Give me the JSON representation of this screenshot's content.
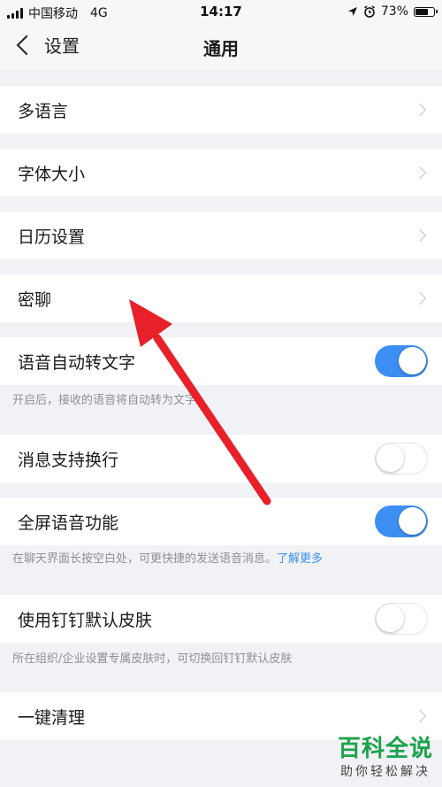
{
  "status_bar": {
    "carrier": "中国移动",
    "network": "4G",
    "time": "14:17",
    "battery_percent": "73%",
    "battery_level": 0.73
  },
  "nav": {
    "back_label": "设置",
    "title": "通用"
  },
  "rows": {
    "language": "多语言",
    "font_size": "字体大小",
    "calendar": "日历设置",
    "secret_chat": "密聊",
    "voice_to_text": "语音自动转文字",
    "line_break": "消息支持换行",
    "fullscreen_voice": "全屏语音功能",
    "default_skin": "使用钉钉默认皮肤",
    "cleanup": "一键清理"
  },
  "toggles": {
    "voice_to_text": true,
    "line_break": false,
    "fullscreen_voice": true,
    "default_skin": false
  },
  "hints": {
    "voice_to_text": "开启后，接收的语音将自动转为文字。",
    "fullscreen_voice": "在聊天界面长按空白处，可更快捷的发送语音消息。",
    "fullscreen_voice_link": "了解更多",
    "default_skin": "所在组织/企业设置专属皮肤时，可切换回钉钉默认皮肤"
  },
  "watermark": {
    "brand": "百科全说",
    "tagline": "助你轻松解决"
  },
  "colors": {
    "accent": "#3d8ff3",
    "annotation_arrow": "#e8202a",
    "watermark_green": "#1aa34a"
  }
}
